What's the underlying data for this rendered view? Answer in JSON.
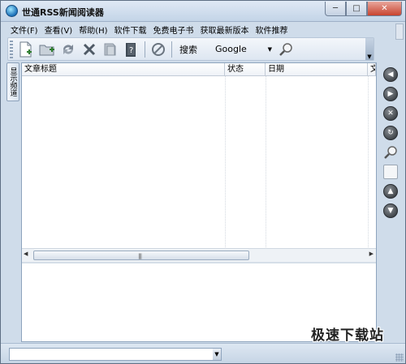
{
  "window": {
    "title": "世通RSS新闻阅读器",
    "controls": {
      "minimize": "─",
      "maximize": "□",
      "close": "✕"
    }
  },
  "menu": [
    "文件(F)",
    "查看(V)",
    "帮助(H)",
    "软件下载",
    "免费电子书",
    "获取最新版本",
    "软件推荐"
  ],
  "toolbar": {
    "search_label": "搜索",
    "engine": "Google",
    "icons": [
      "new-item-icon",
      "add-folder-icon",
      "refresh-icon",
      "delete-icon",
      "mark-read-icon",
      "help-book-icon",
      "stop-icon"
    ]
  },
  "side_tab": {
    "label": "显示频道"
  },
  "list": {
    "columns": [
      "文章标题",
      "状态",
      "日期",
      "文"
    ]
  },
  "right_tools": [
    "back-icon",
    "forward-icon",
    "stop-icon",
    "refresh-icon",
    "zoom-icon",
    "page-icon",
    "scroll-up-icon",
    "scroll-down-icon"
  ],
  "watermark": "极速下载站"
}
